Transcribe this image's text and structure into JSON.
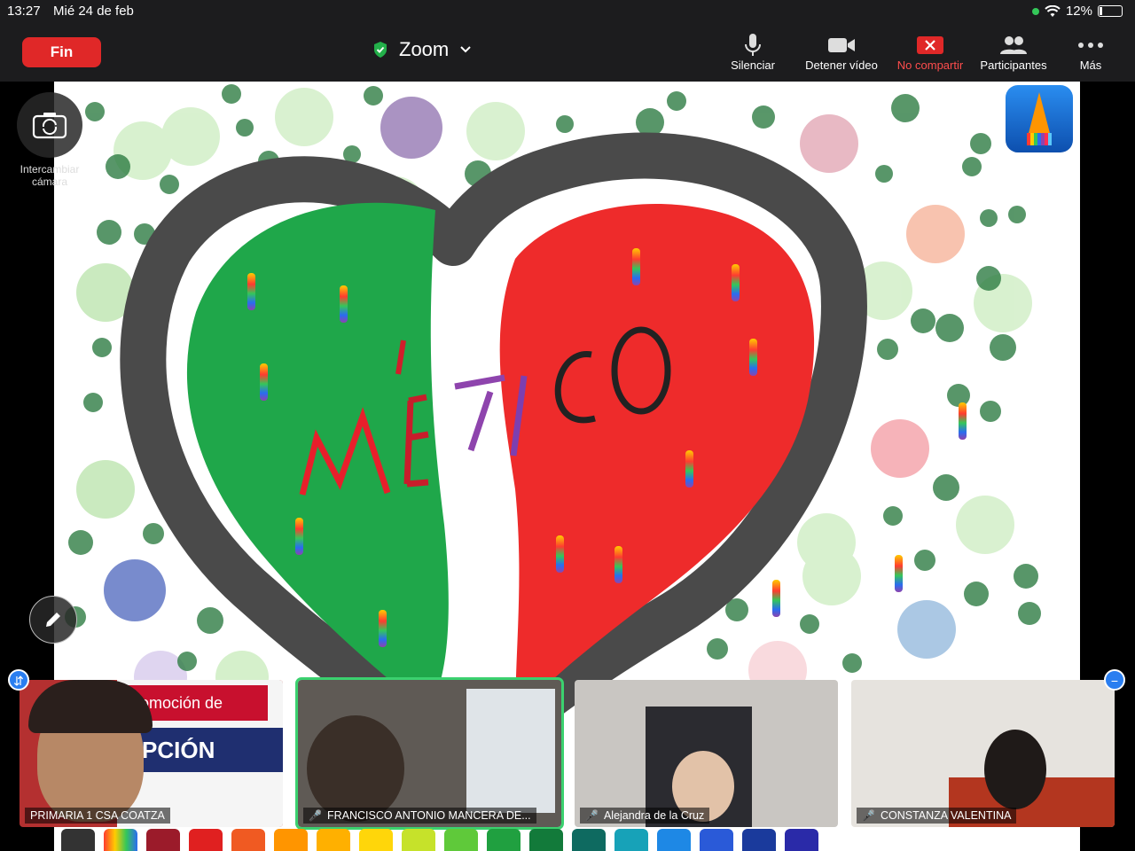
{
  "status_bar": {
    "time": "13:27",
    "date": "Mié 24 de feb",
    "battery": "12%"
  },
  "toolbar": {
    "end_label": "Fin",
    "title": "Zoom",
    "items": [
      {
        "label": "Silenciar",
        "icon": "microphone-icon"
      },
      {
        "label": "Detener vídeo",
        "icon": "video-camera-icon"
      },
      {
        "label": "No compartir",
        "icon": "stop-share-icon"
      },
      {
        "label": "Participantes",
        "icon": "participants-icon"
      },
      {
        "label": "Más",
        "icon": "more-dots-icon"
      }
    ]
  },
  "side": {
    "switch_camera_label": "Intercambiar cámara"
  },
  "drawing": {
    "text": "MÉXICO"
  },
  "participants": [
    {
      "name": "PRIMARIA 1 CSA COATZA",
      "muted": false,
      "bg_text_1": "romoción de",
      "bg_text_2": "PCIÓN"
    },
    {
      "name": "FRANCISCO ANTONIO MANCERA DE...",
      "muted": true
    },
    {
      "name": "Alejandra de la Cruz",
      "muted": true
    },
    {
      "name": "CONSTANZA VALENTINA",
      "muted": true
    }
  ],
  "colors": {
    "end_button": "#e02828",
    "active_speaker": "#3bd16f",
    "stop_share": "#ff4d4d"
  }
}
